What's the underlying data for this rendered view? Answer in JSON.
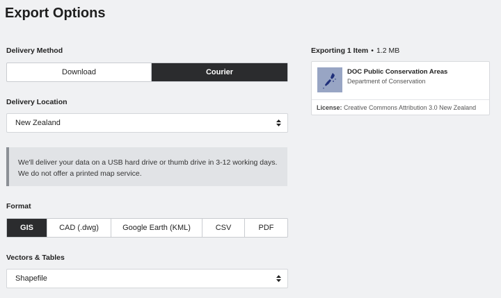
{
  "page": {
    "title": "Export Options"
  },
  "delivery": {
    "label": "Delivery Method",
    "options": [
      "Download",
      "Courier"
    ],
    "selected": "Courier"
  },
  "location": {
    "label": "Delivery Location",
    "value": "New Zealand"
  },
  "notice": {
    "text": "We'll deliver your data on a USB hard drive or thumb drive in 3-12 working days. We do not offer a printed map service."
  },
  "format": {
    "label": "Format",
    "options": [
      "GIS",
      "CAD (.dwg)",
      "Google Earth (KML)",
      "CSV",
      "PDF"
    ],
    "selected": "GIS"
  },
  "vectors": {
    "label": "Vectors & Tables",
    "value": "Shapefile"
  },
  "export": {
    "count_label": "Exporting 1 Item",
    "separator": "•",
    "size": "1.2 MB",
    "item": {
      "title": "DOC Public Conservation Areas",
      "organization": "Department of Conservation",
      "license_label": "License:",
      "license_value": "Creative Commons Attribution 3.0 New Zealand",
      "thumbnail_icon": "new-zealand-map-thumbnail"
    }
  },
  "colors": {
    "background": "#f0f1f3",
    "active_segment": "#2b2c2e",
    "thumbnail_bg": "#98a5c4",
    "notice_bg": "#e1e3e6"
  }
}
